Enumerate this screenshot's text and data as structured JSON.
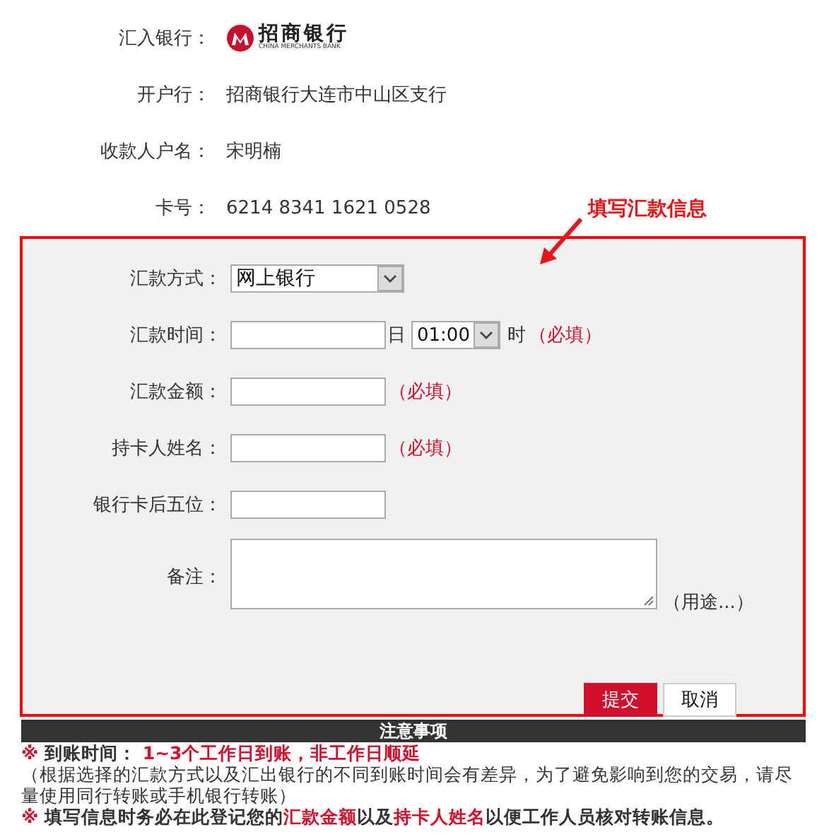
{
  "info_rows": [
    {
      "label": "汇入银行：",
      "kind": "logo",
      "logo_name": "招商银行",
      "logo_subtitle": "CHINA MERCHANTS BANK"
    },
    {
      "label": "开户行：",
      "kind": "text",
      "value": "招商银行大连市中山区支行"
    },
    {
      "label": "收款人户名：",
      "kind": "text",
      "value": "宋明楠"
    },
    {
      "label": "卡号：",
      "kind": "text",
      "value": "6214 8341 1621 0528"
    }
  ],
  "annotation": "填写汇款信息",
  "form_rows": [
    {
      "label": "汇款方式：",
      "kind": "select",
      "value": "网上银行"
    },
    {
      "label": "汇款时间：",
      "kind": "datetime",
      "day_unit": "日",
      "hour_value": "01:00",
      "hour_unit": "时",
      "required_note": "（必填）"
    },
    {
      "label": "汇款金额：",
      "kind": "input",
      "required_note": "（必填）"
    },
    {
      "label": "持卡人姓名：",
      "kind": "input",
      "required_note": "（必填）"
    },
    {
      "label": "银行卡后五位：",
      "kind": "input"
    },
    {
      "label": "备注：",
      "kind": "textarea",
      "hint": "（用途...）"
    }
  ],
  "buttons": [
    {
      "label": "提交",
      "primary": true
    },
    {
      "label": "取消",
      "primary": false
    }
  ],
  "notice": {
    "title": "注意事项",
    "lines": [
      {
        "kind": "bold",
        "segments": [
          {
            "text": "※ ",
            "red": true
          },
          {
            "text": "到账时间： ",
            "red": false
          },
          {
            "text": "1~3个工作日到账，非工作日顺延",
            "red": true
          }
        ]
      },
      {
        "kind": "plain",
        "segments": [
          {
            "text": "（根据选择的汇款方式以及汇出银行的不同到账时间会有差异，为了避免影响到您的交易，请尽量使用同行转账或手机银行转账）",
            "red": false
          }
        ]
      },
      {
        "kind": "bold",
        "segments": [
          {
            "text": "※ ",
            "red": true
          },
          {
            "text": "填写信息时务必在此登记您的",
            "red": false
          },
          {
            "text": "汇款金额",
            "red": true
          },
          {
            "text": "以及",
            "red": false
          },
          {
            "text": "持卡人姓名",
            "red": true
          },
          {
            "text": "以便工作人员核对转账信息。",
            "red": false
          }
        ]
      }
    ]
  }
}
